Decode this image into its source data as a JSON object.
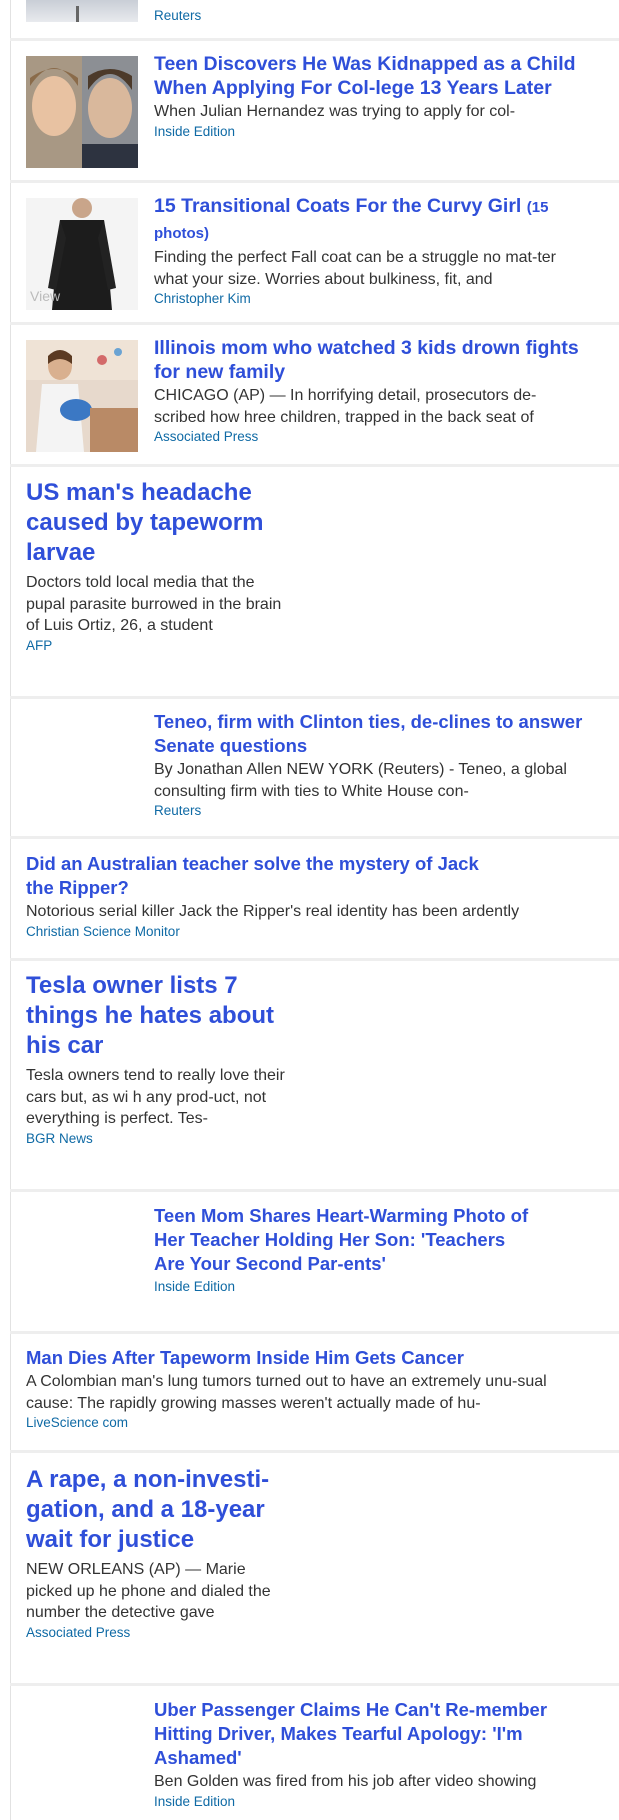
{
  "stories": [
    {
      "source": "Reuters"
    },
    {
      "title": "Teen Discovers He Was Kidnapped as a Child When Applying For Col-lege 13 Years Later",
      "summary": "When Julian Hernandez was trying to apply for col-",
      "source": "Inside Edition",
      "thumb_icon": "boy-portrait-photo"
    },
    {
      "title": "15 Transitional Coats For the Curvy Girl",
      "count": "(15 photos)",
      "summary": "Finding the perfect Fall coat can be a struggle no mat-ter what your size. Worries about bulkiness, fit, and",
      "source": "Christopher Kim",
      "thumb_icon": "black-coat-photo",
      "thumb_label": "View"
    },
    {
      "title": "Illinois mom who watched 3 kids drown fights for new family",
      "summary": "CHICAGO (AP) — In horrifying detail, prosecutors de-scribed how  hree children, trapped in the back seat of",
      "source": "Associated Press",
      "thumb_icon": "mother-room-photo"
    },
    {
      "title": "US man's headache caused by tapeworm larvae",
      "summary": "Doctors told local media that the pupal parasite burrowed in the brain of Luis Ortiz, 26, a student",
      "source": "AFP"
    },
    {
      "title": "Teneo, firm with Clinton ties, de-clines to answer Senate questions",
      "summary": "By Jonathan Allen NEW YORK (Reuters) - Teneo, a global consulting firm with ties to White House con-",
      "source": "Reuters"
    },
    {
      "title": "Did an Australian teacher solve the mystery of Jack the Ripper?",
      "summary": "Notorious serial killer Jack the Ripper's real identity has been ardently",
      "source": "Christian Science Monitor"
    },
    {
      "title": "Tesla owner lists 7 things he hates about his car",
      "summary": "Tesla owners tend to really love their cars but, as wi h any prod-uct, not everything is perfect. Tes-",
      "source": "BGR News"
    },
    {
      "title": "Teen Mom Shares Heart-Warming Photo of Her Teacher Holding Her Son: 'Teachers Are Your Second Par-ents'",
      "source": "Inside Edition"
    },
    {
      "title": "Man Dies After Tapeworm Inside Him Gets Cancer",
      "summary": "A Colombian man's lung tumors turned out to have an extremely unu-sual cause: The rapidly growing masses weren't actually made of hu-",
      "source": "LiveScience com"
    },
    {
      "title": "A rape, a non-investi-gation, and a 18-year wait for justice",
      "summary": "NEW ORLEANS (AP) — Marie picked up  he phone and dialed the number the detective gave",
      "source": "Associated Press"
    },
    {
      "title": "Uber Passenger Claims He Can't Re-member Hitting Driver, Makes Tearful Apology: 'I'm Ashamed'",
      "summary": "Ben Golden was fired from his job after video showing",
      "source": "Inside Edition"
    }
  ],
  "colors": {
    "title": "#2f4fd9",
    "source": "#0f6aa5",
    "summary": "#333333",
    "divider": "#eeeeee"
  }
}
